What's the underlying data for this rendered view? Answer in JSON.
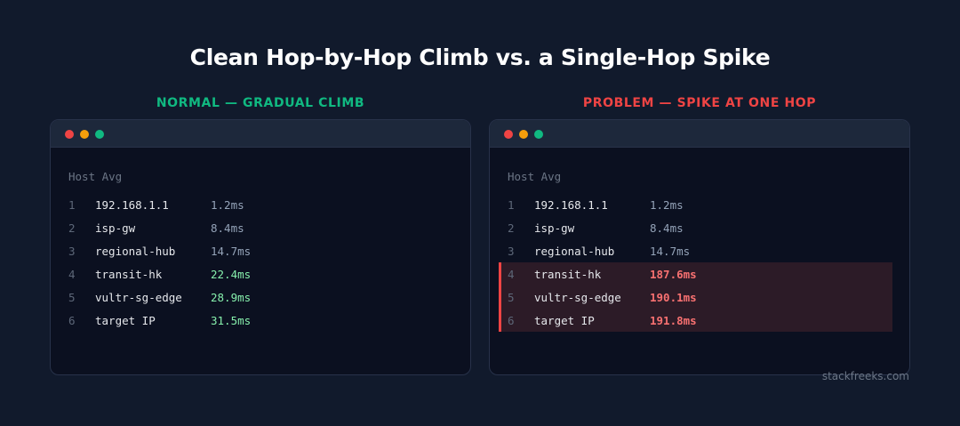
{
  "title": "Clean Hop-by-Hop Climb vs. a Single-Hop Spike",
  "credit": "stackfreeks.com",
  "colors": {
    "normal_label": "#10b981",
    "problem_label": "#ef4444",
    "plain_value": "#94a3b8",
    "good_value": "#86efac",
    "spike_value": "#f87171"
  },
  "panels": [
    {
      "label": "NORMAL — GRADUAL CLIMB",
      "header": "Host Avg",
      "rows": [
        {
          "num": "1",
          "host": "192.168.1.1",
          "avg": "1.2ms",
          "state": "plain"
        },
        {
          "num": "2",
          "host": "isp-gw",
          "avg": "8.4ms",
          "state": "plain"
        },
        {
          "num": "3",
          "host": "regional-hub",
          "avg": "14.7ms",
          "state": "plain"
        },
        {
          "num": "4",
          "host": "transit-hk",
          "avg": "22.4ms",
          "state": "good"
        },
        {
          "num": "5",
          "host": "vultr-sg-edge",
          "avg": "28.9ms",
          "state": "good"
        },
        {
          "num": "6",
          "host": "target IP",
          "avg": "31.5ms",
          "state": "good"
        }
      ]
    },
    {
      "label": "PROBLEM — SPIKE AT ONE HOP",
      "header": "Host Avg",
      "rows": [
        {
          "num": "1",
          "host": "192.168.1.1",
          "avg": "1.2ms",
          "state": "plain"
        },
        {
          "num": "2",
          "host": "isp-gw",
          "avg": "8.4ms",
          "state": "plain"
        },
        {
          "num": "3",
          "host": "regional-hub",
          "avg": "14.7ms",
          "state": "plain"
        },
        {
          "num": "4",
          "host": "transit-hk",
          "avg": "187.6ms",
          "state": "spike"
        },
        {
          "num": "5",
          "host": "vultr-sg-edge",
          "avg": "190.1ms",
          "state": "spike"
        },
        {
          "num": "6",
          "host": "target IP",
          "avg": "191.8ms",
          "state": "spike"
        }
      ]
    }
  ]
}
